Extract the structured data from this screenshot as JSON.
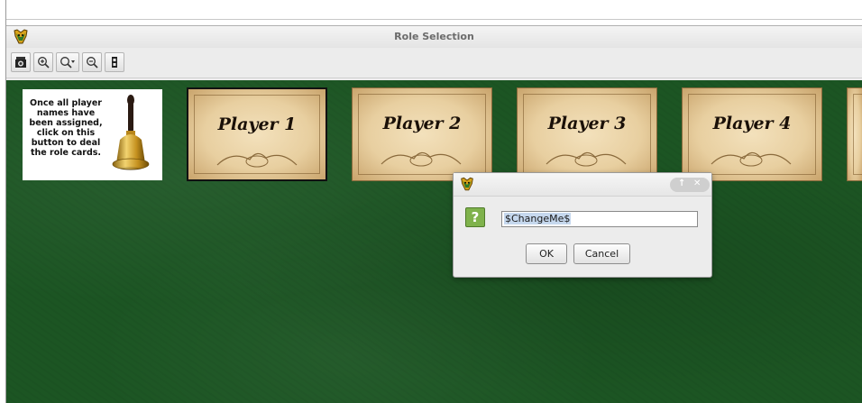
{
  "window": {
    "title": "Role Selection",
    "app_icon": "wolf-app-icon"
  },
  "toolbar": {
    "buttons": [
      {
        "name": "camera-icon"
      },
      {
        "name": "zoom-in-icon"
      },
      {
        "name": "zoom-dropdown-icon"
      },
      {
        "name": "zoom-out-icon"
      },
      {
        "name": "tall-icon"
      }
    ]
  },
  "board": {
    "bell_card": {
      "text": "Once all player names have been assigned, click on this button to deal the role cards.",
      "icon": "bell-icon"
    },
    "players": [
      {
        "label": "Player 1",
        "selected": true
      },
      {
        "label": "Player 2",
        "selected": false
      },
      {
        "label": "Player 3",
        "selected": false
      },
      {
        "label": "Player 4",
        "selected": false
      }
    ]
  },
  "dialog": {
    "question_icon": "?",
    "input_value": "$ChangeMe$",
    "ok_label": "OK",
    "cancel_label": "Cancel",
    "controls": [
      "↑",
      "✕"
    ]
  },
  "colors": {
    "felt": "#1c5523",
    "card": "#e8cfa0",
    "dialog_bg": "#ececec",
    "question_bg": "#7fb24c"
  }
}
